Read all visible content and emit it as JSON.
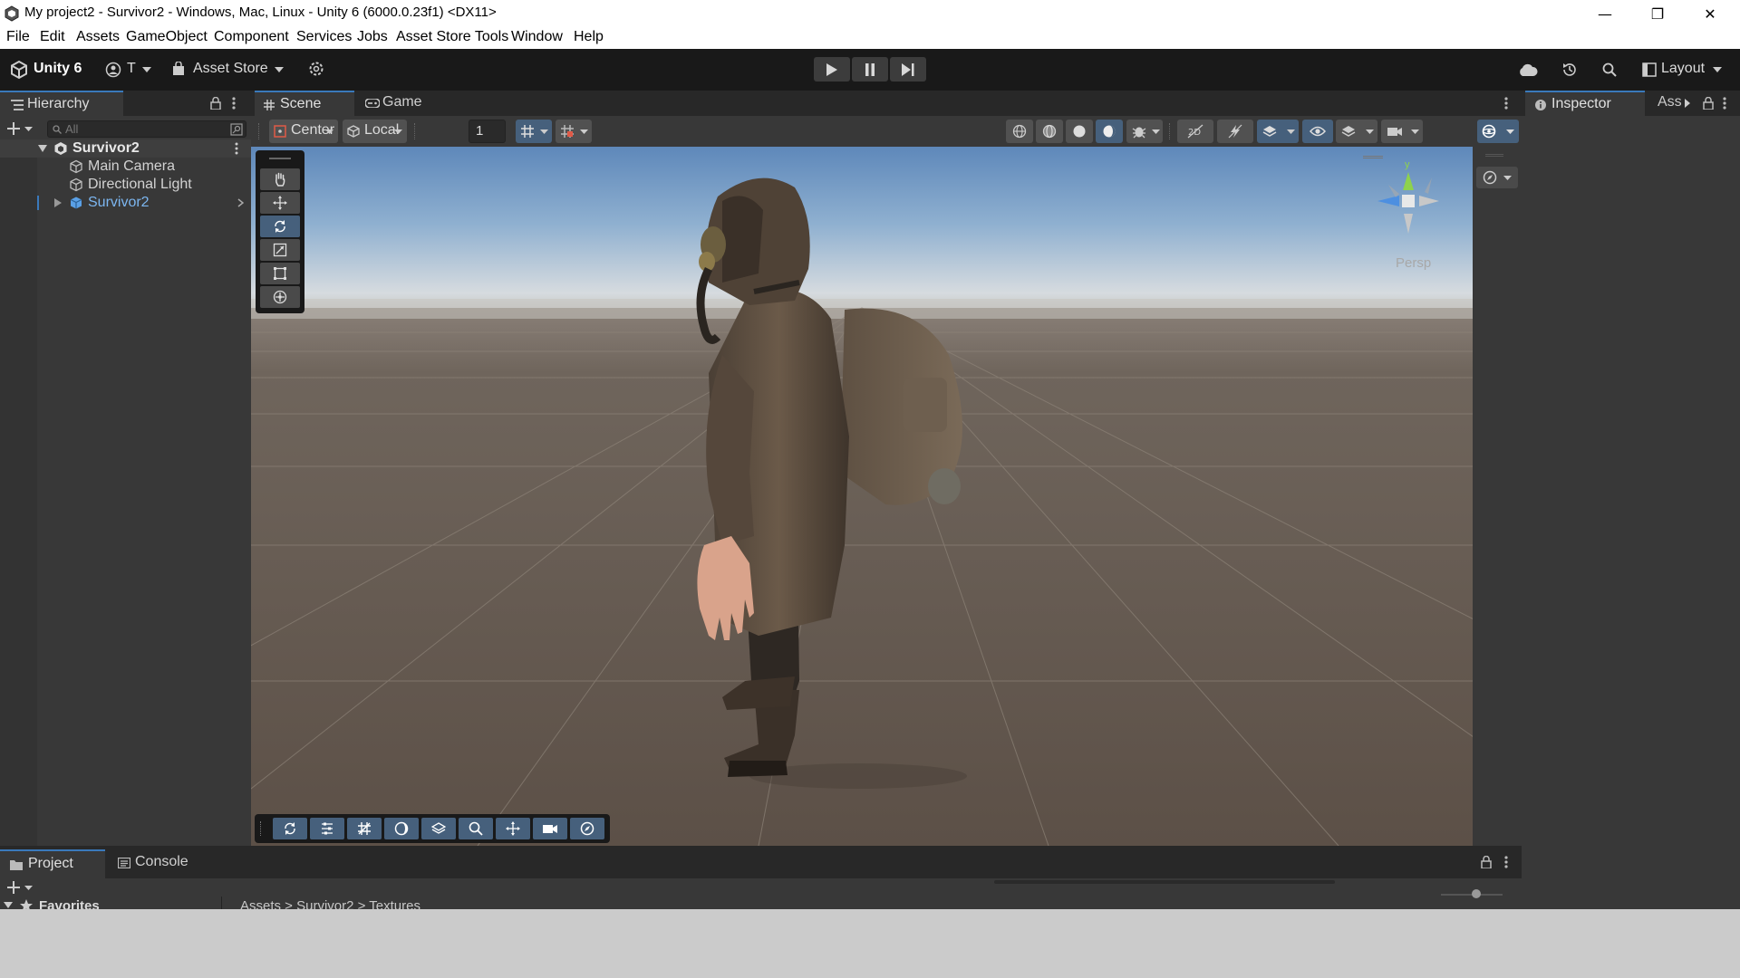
{
  "window": {
    "title": "My project2 - Survivor2 - Windows, Mac, Linux - Unity 6 (6000.0.23f1) <DX11>",
    "minimize": "—",
    "restore": "❐",
    "close": "✕"
  },
  "menu": [
    "File",
    "Edit",
    "Assets",
    "GameObject",
    "Component",
    "Services",
    "Jobs",
    "Asset Store Tools",
    "Window",
    "Help"
  ],
  "toolbar": {
    "brand": "Unity 6",
    "account": "T",
    "asset_store": "Asset Store",
    "layout": "Layout"
  },
  "hierarchy": {
    "tab": "Hierarchy",
    "search_placeholder": "All",
    "scene_name": "Survivor2",
    "items": [
      "Main Camera",
      "Directional Light",
      "Survivor2"
    ]
  },
  "scene": {
    "tabs": [
      "Scene",
      "Game"
    ],
    "pivot": "Center",
    "space": "Local",
    "grid_snap": "1",
    "view_label": "Persp",
    "gizmo_axis_label": "y"
  },
  "inspector": {
    "tabs": [
      "Inspector",
      "Ass"
    ]
  },
  "project": {
    "tabs": [
      "Project",
      "Console"
    ],
    "favorites": "Favorites",
    "breadcrumb": "Assets > Survivor2 > Textures"
  },
  "colors": {
    "accent": "#3a79bb",
    "active_tool": "#46607c",
    "selected_item": "#7cb6f0"
  }
}
